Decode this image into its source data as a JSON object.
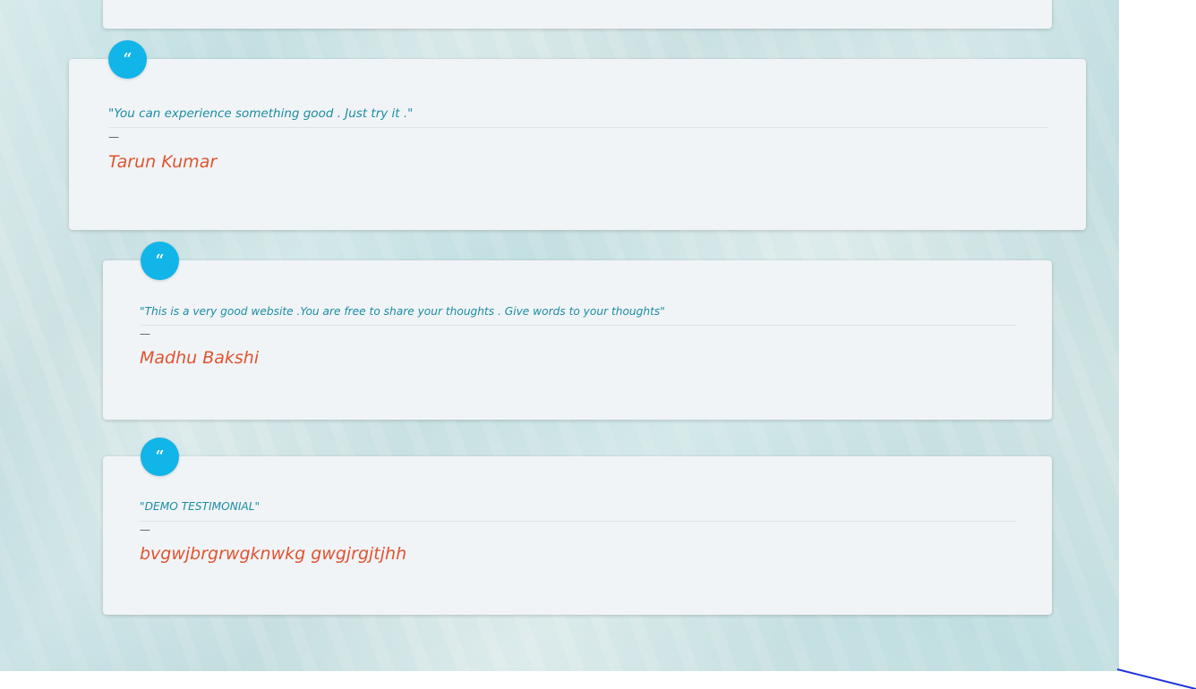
{
  "testimonials": [
    {
      "quote_icon": "quote-left-icon",
      "quote_glyph": "“",
      "text": "\"You can experience something good . Just try it .\"",
      "dash": "—",
      "author": "Tarun Kumar"
    },
    {
      "quote_icon": "quote-left-icon",
      "quote_glyph": "“",
      "text": "\"This is a very good website .You are free to share your thoughts . Give words to your thoughts\"",
      "dash": "—",
      "author": "Madhu Bakshi"
    },
    {
      "quote_icon": "quote-left-icon",
      "quote_glyph": "“",
      "text": "\"DEMO TESTIMONIAL\"",
      "dash": "—",
      "author": "bvgwjbrgrwgknwkg gwgjrgjtjhh"
    }
  ],
  "colors": {
    "badge": "#12b5e8",
    "quote_text": "#1b8ca3",
    "author": "#e0532e",
    "card_bg": "#f1f4f7"
  }
}
